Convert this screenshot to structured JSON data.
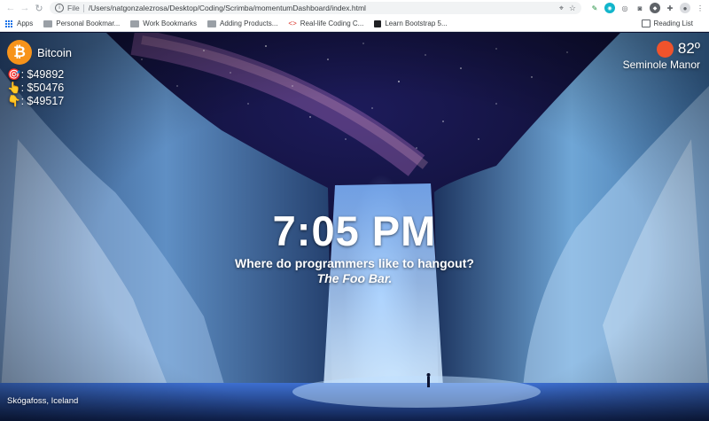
{
  "browser": {
    "url_scheme": "File",
    "url": "/Users/natgonzalezrosa/Desktop/Coding/Scrimba/momentumDashboard/index.html",
    "bookmarks": [
      {
        "label": "Apps",
        "icon": "apps-grid-icon"
      },
      {
        "label": "Personal Bookmar...",
        "icon": "folder-icon"
      },
      {
        "label": "Work Bookmarks",
        "icon": "folder-icon"
      },
      {
        "label": "Adding Products...",
        "icon": "folder-icon"
      },
      {
        "label": "Real-life Coding C...",
        "icon": "code-icon"
      },
      {
        "label": "Learn Bootstrap 5...",
        "icon": "site-icon"
      }
    ],
    "reading_list": "Reading List"
  },
  "crypto": {
    "name": "Bitcoin",
    "icon": "bitcoin-icon",
    "prices": [
      {
        "emoji": "🎯",
        "value": ": $49892"
      },
      {
        "emoji": "👆",
        "value": ": $50476"
      },
      {
        "emoji": "👇",
        "value": ": $49517"
      }
    ]
  },
  "weather": {
    "temp": "82º",
    "city": "Seminole Manor",
    "icon": "sun-icon"
  },
  "clock": {
    "time": "7:05 PM"
  },
  "joke": {
    "setup": "Where do programmers like to hangout?",
    "punchline": "The Foo Bar."
  },
  "photo": {
    "location": "Skógafoss, Iceland"
  },
  "colors": {
    "bitcoin": "#f7931a",
    "sun": "#f0532c"
  }
}
